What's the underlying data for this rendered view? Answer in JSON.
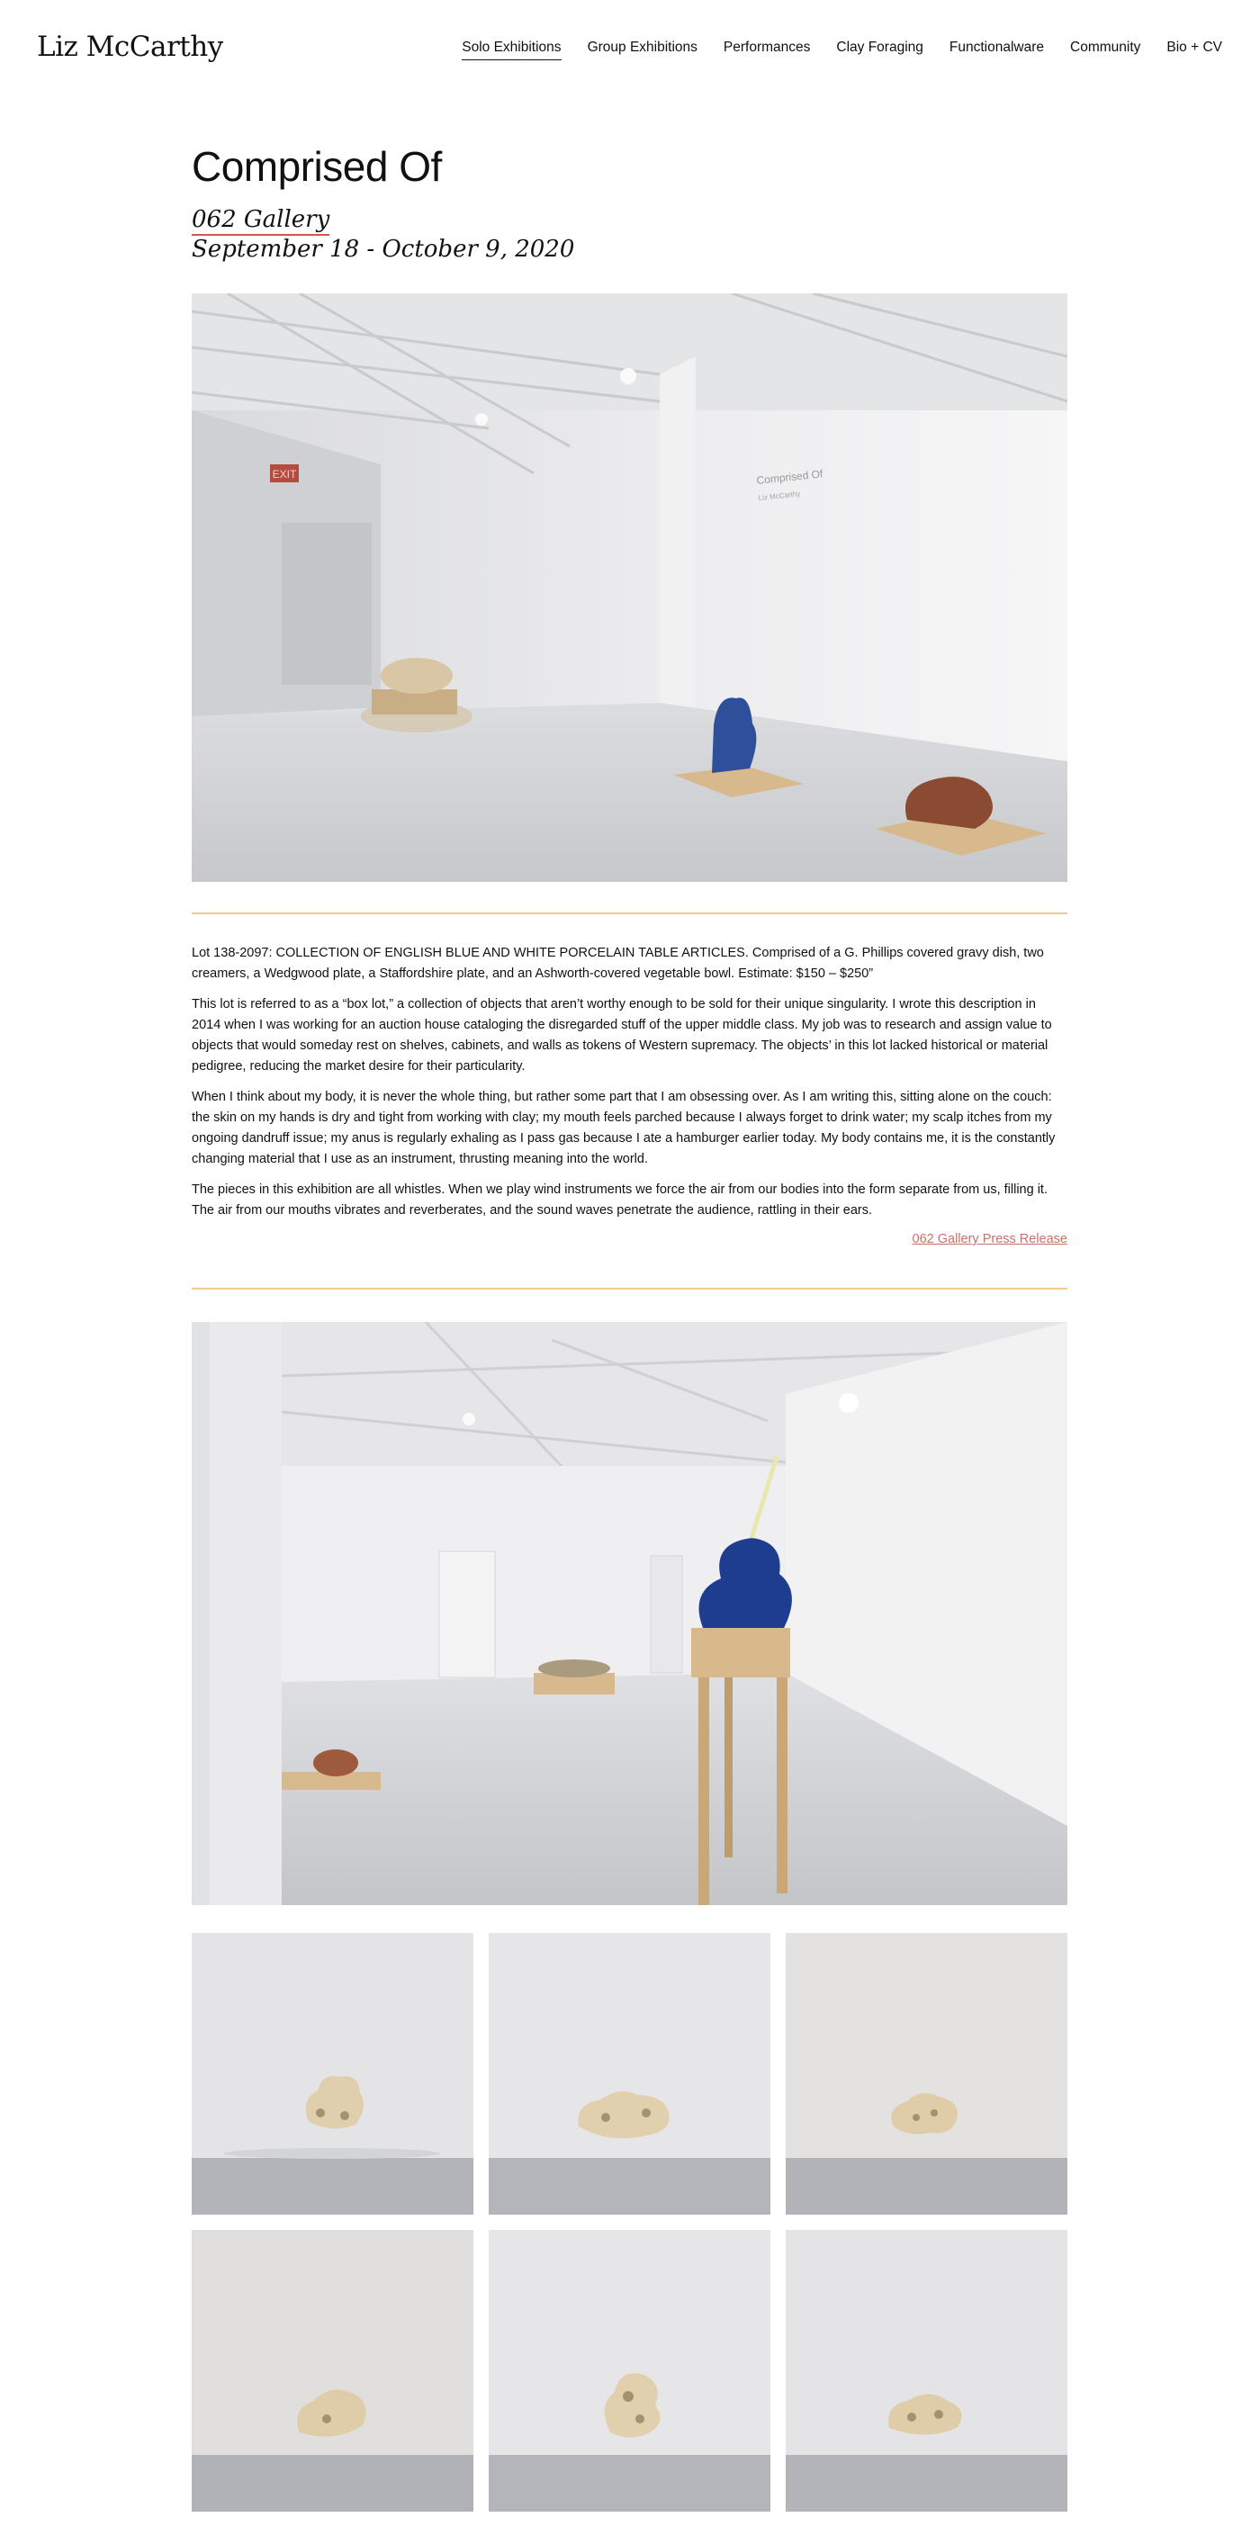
{
  "site": {
    "name": "Liz McCarthy"
  },
  "nav": [
    {
      "label": "Solo Exhibitions",
      "active": true
    },
    {
      "label": "Group Exhibitions"
    },
    {
      "label": "Performances"
    },
    {
      "label": "Clay Foraging"
    },
    {
      "label": "Functionalware"
    },
    {
      "label": "Community"
    },
    {
      "label": "Bio + CV"
    }
  ],
  "exhibition": {
    "title": "Comprised Of",
    "gallery": "062 Gallery",
    "dates": "September 18 - October 9, 2020"
  },
  "installation_wall_text": {
    "title": "Comprised Of",
    "artist": "Liz McCarthy"
  },
  "exit_sign": "EXIT",
  "body": {
    "paragraphs": [
      "Lot 138-2097: COLLECTION OF ENGLISH BLUE AND WHITE PORCELAIN TABLE ARTICLES. Comprised of a G. Phillips covered gravy dish, two creamers, a Wedgwood plate, a Staffordshire plate, and an Ashworth-covered vegetable bowl. Estimate: $150 – $250”",
      "This lot is referred to as a “box lot,” a collection of objects that aren’t worthy enough to be sold for their unique singularity. I wrote this description in 2014 when I was working for an auction house cataloging the disregarded stuff of the upper middle class. My job was to research and assign value to objects that would someday rest on shelves, cabinets, and walls as tokens of Western supremacy. The objects’ in this lot lacked historical or material pedigree, reducing the market desire for their particularity.",
      "When I think about my body, it is never the whole thing, but rather some part that I am obsessing over. As I am writing this, sitting alone on the couch: the skin on my hands is dry and tight from working with clay; my mouth feels parched because I always forget to drink water; my scalp itches from my ongoing dandruff issue; my anus is regularly exhaling as I pass gas because I ate a hamburger earlier today. My body contains me, it is the constantly changing material that I use as an instrument, thrusting meaning into the world.",
      "The pieces in this exhibition are all whistles. When we play wind instruments we force the air from our bodies into the form separate from us, filling it. The air from our mouths vibrates and reverberates, and the sound waves penetrate the audience, rattling in their ears."
    ],
    "press_link": "062 Gallery Press Release"
  },
  "colors": {
    "rule": "#f7c98f",
    "link_underline": "#d9534f",
    "press_link": "#c9716a"
  }
}
